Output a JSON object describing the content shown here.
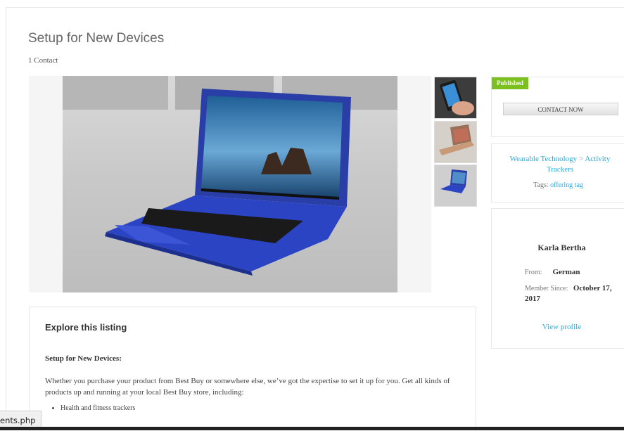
{
  "listing": {
    "title": "Setup for New Devices",
    "contact_count": "1 Contact"
  },
  "gallery": {
    "main_image": "laptop-photo",
    "thumbnails": [
      "phone-in-hand-photo",
      "laptop-gold-photo",
      "laptop-blue-photo"
    ]
  },
  "sidebar": {
    "status_badge": "Published",
    "contact_button": "CONTACT NOW",
    "category_1": "Wearable Technology",
    "separator": ">",
    "category_2": "Activity Trackers",
    "tags_label": "Tags:",
    "tag": "offering tag",
    "author_name": "Karla Bertha",
    "from_label": "From:",
    "from_value": "German",
    "member_since_label": "Member Since:",
    "member_since_value": "October 17, 2017",
    "view_profile": "View profile"
  },
  "explore": {
    "heading": "Explore this listing",
    "subheading": "Setup for New Devices:",
    "paragraph": "Whether you purchase your product from Best Buy or somewhere else, we’ve got the expertise to set it up for you. Get all kinds of products up and running at your local Best Buy store, including:",
    "bullets": [
      "Health and fitness trackers"
    ]
  },
  "status_bar": {
    "url": "ents.php"
  },
  "colors": {
    "accent": "#29a9d9",
    "badge": "#7cc020"
  }
}
